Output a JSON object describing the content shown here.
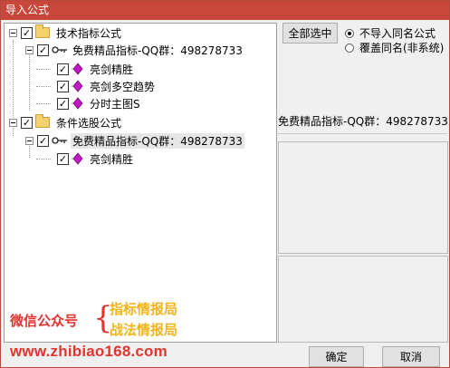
{
  "window": {
    "title": "导入公式"
  },
  "tree": {
    "nodes": [
      {
        "label": "技术指标公式",
        "checked": true,
        "type": "folder"
      },
      {
        "label": "免费精品指标-QQ群：498278733",
        "checked": true,
        "type": "key"
      },
      {
        "label": "亮剑精胜",
        "checked": true,
        "type": "gem"
      },
      {
        "label": "亮剑多空趋势",
        "checked": true,
        "type": "gem"
      },
      {
        "label": "分时主图S",
        "checked": true,
        "type": "gem"
      },
      {
        "label": "条件选股公式",
        "checked": true,
        "type": "folder"
      },
      {
        "label": "免费精品指标-QQ群：498278733",
        "checked": true,
        "type": "key",
        "selected": true
      },
      {
        "label": "亮剑精胜",
        "checked": true,
        "type": "gem"
      }
    ]
  },
  "options": {
    "select_all_label": "全部选中",
    "radio_skip_label": "不导入同名公式",
    "radio_overwrite_label": "覆盖同名(非系统)",
    "selected": "skip"
  },
  "info": {
    "text": "免费精品指标-QQ群：498278733"
  },
  "promo": {
    "label": "微信公众号",
    "brace": "{",
    "line1": "指标情报局",
    "line2": "战法情报局",
    "url": "www.zhibiao168.com"
  },
  "buttons": {
    "ok_label": "确定",
    "cancel_label": "取消"
  },
  "colors": {
    "titlebar": "#c9473a",
    "promo_red": "#e3342f",
    "promo_gold": "#f2b417",
    "gem": "#c516c5"
  }
}
